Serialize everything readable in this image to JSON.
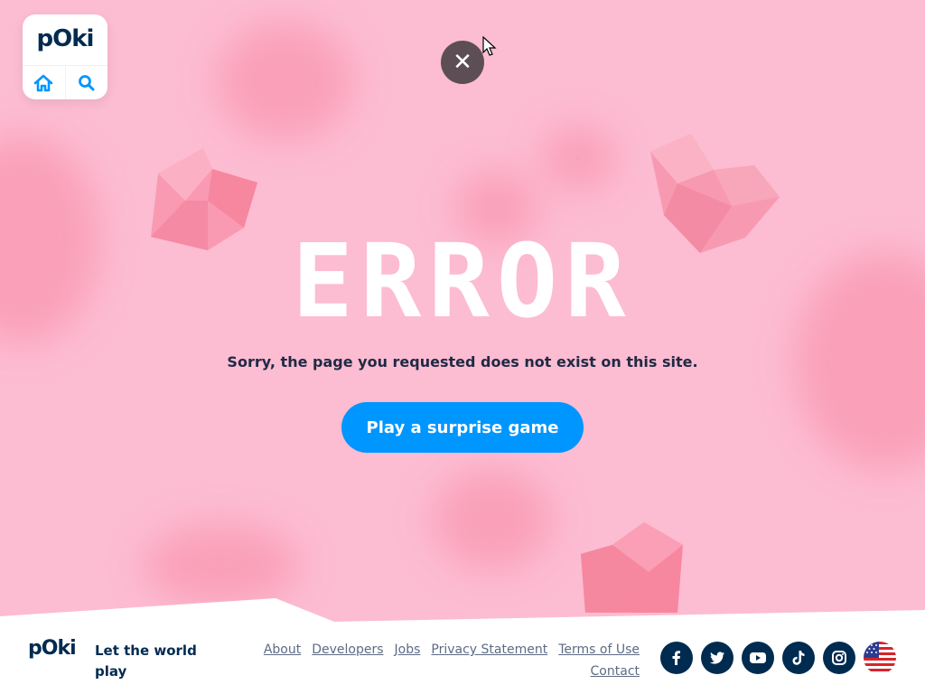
{
  "brand": {
    "logo_text": "pOki",
    "tagline": "Let the world play"
  },
  "header": {
    "home_icon": "home-icon",
    "search_icon": "search-icon",
    "close_icon": "close-icon",
    "close_symbol": "✕"
  },
  "main": {
    "error_title": "ERROR",
    "message": "Sorry, the page you requested does not exist on this site.",
    "cta_label": "Play a surprise game"
  },
  "footer": {
    "links": [
      "About",
      "Developers",
      "Jobs",
      "Privacy Statement",
      "Terms of Use",
      "Contact"
    ],
    "social": [
      "facebook-icon",
      "twitter-icon",
      "youtube-icon",
      "tiktok-icon",
      "instagram-icon"
    ],
    "language_flag": "us-flag-icon"
  },
  "colors": {
    "background": "#fcbcd2",
    "accent": "#0096ff",
    "brand_dark": "#002b50",
    "heart": "#f98aa6",
    "text": "#1f2a44"
  }
}
